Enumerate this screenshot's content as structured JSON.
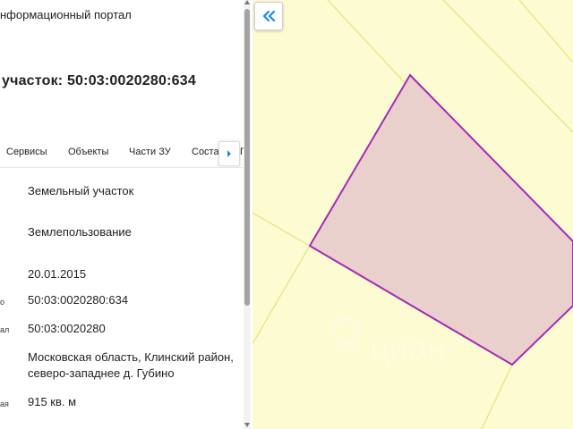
{
  "header": {
    "portal_title": "нформационный портал",
    "parcel_title": "участок: 50:03:0020280:634"
  },
  "tabs": [
    {
      "label": "Сервисы"
    },
    {
      "label": "Объекты"
    },
    {
      "label": "Части ЗУ"
    },
    {
      "label": "Соста"
    },
    {
      "label": "Г"
    }
  ],
  "tabs_more_icon": "chevron-right-icon",
  "details": [
    {
      "label": "",
      "value": "Земельный участок"
    },
    {
      "label": "",
      "value": "Землепользование"
    },
    {
      "label": "",
      "value": "20.01.2015"
    },
    {
      "label": "о",
      "value": "50:03:0020280:634"
    },
    {
      "label": "ал",
      "value": "50:03:0020280"
    },
    {
      "label": "",
      "value": "Московская область, Клинский район, северо-западнее д. Губино"
    },
    {
      "label": "ая",
      "value": "915 кв. м"
    }
  ],
  "map": {
    "collapse_icon": "double-chevron-left-icon",
    "watermark": "циан",
    "colors": {
      "background": "#fdfbd2",
      "parcel_fill": "#e9cdcc",
      "parcel_border": "#a52bb5",
      "boundary_lines": "#e6e27a",
      "accent": "#1e88e5"
    }
  }
}
